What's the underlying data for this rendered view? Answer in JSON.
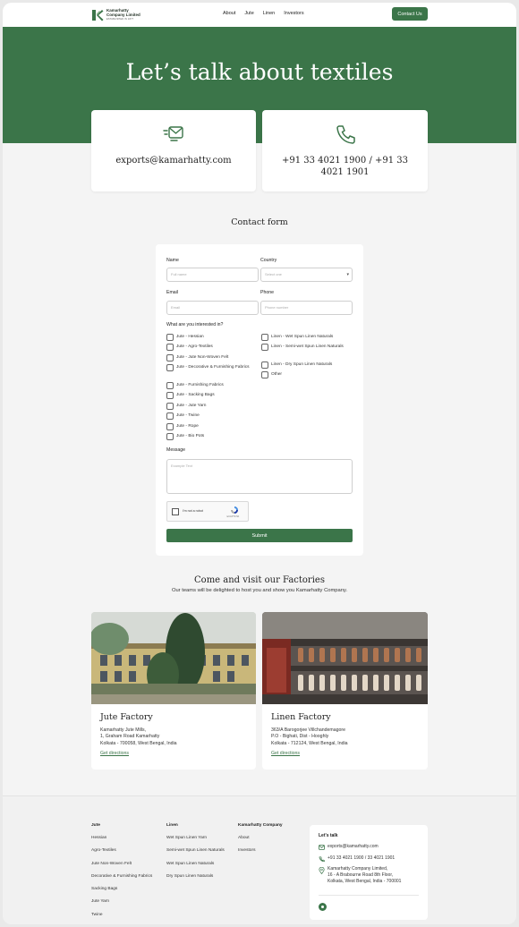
{
  "header": {
    "company_line1": "Kamarhatty",
    "company_line2": "Company Limited",
    "tagline": "ESTABLISHED IN 1877",
    "nav": [
      "About",
      "Jute",
      "Linen",
      "Investors"
    ],
    "cta": "Contact Us"
  },
  "hero": {
    "title": "Let’s talk about textiles",
    "email": "exports@kamarhatty.com",
    "phone": "+91 33 4021 1900 / +91 33 4021 1901"
  },
  "form": {
    "title": "Contact form",
    "name_label": "Name",
    "name_placeholder": "Full name",
    "country_label": "Country",
    "country_value": "Select one",
    "email_label": "Email",
    "email_placeholder": "Email",
    "phone_label": "Phone",
    "phone_placeholder": "Phone number",
    "interest_label": "What are you interested in?",
    "interests_left": [
      "Jute - Hessian",
      "Jute - Agro-Textiles",
      "Jute - Jute Non-Woven Felt",
      "Jute - Decorative & Furnishing Fabrics",
      "Jute - Furnishing Fabrics",
      "Jute - Sacking Bags",
      "Jute - Jute Yarn",
      "Jute - Twine",
      "Jute - Rope",
      "Jute - Bio Pots"
    ],
    "interests_right": [
      "Linen - Wet Spun Linen Naturals",
      "Linen - Semi-wet Spun Linen Naturals",
      "Linen - Dry Spun Linen Naturals",
      "Other"
    ],
    "message_label": "Message",
    "message_placeholder": "Example Text",
    "captcha_text": "I'm not a robot",
    "captcha_brand": "reCAPTCHA",
    "submit": "Submit"
  },
  "factories": {
    "title": "Come and visit our Factories",
    "subtitle": "Our teams will be delighted to host you and show you Kamarhatty Company.",
    "jute": {
      "name": "Jute Factory",
      "addr1": "Kamarhatty Jute Mills,",
      "addr2": "1, Graham Road Kamarhatty",
      "addr3": "Kolkata - 700058, West Bengal, India",
      "link": "Get directions"
    },
    "linen": {
      "name": "Linen Factory",
      "addr1": "363/A Barogorjee Villchandemagore",
      "addr2": "P.O - Bighati, Dist - Hooghly",
      "addr3": "Kolkata - 712124, West Bengal, India",
      "link": "Get directions"
    }
  },
  "footer": {
    "jute_heading": "Jute",
    "jute_items": [
      "Hessian",
      "Agro-Textiles",
      "Jute Non-Woven Felt",
      "Decorative & Furnishing Fabrics",
      "Sacking Bags",
      "Jute Yarn",
      "Twine"
    ],
    "linen_heading": "Linen",
    "linen_items": [
      "Wet Spun Linen Yarn",
      "Semi-wet Spun Linen Naturals",
      "Wet Spun Linen Naturals",
      "Dry Spun Linen Naturals"
    ],
    "company_heading": "Kamarhatty Company",
    "company_items": [
      "About",
      "Investors"
    ],
    "talk_heading": "Let's talk",
    "talk_email": "exports@kamarhatty.com",
    "talk_phone": "+91 33 4021 1900 / 33 4021 1901",
    "talk_addr1": "Kamarhatty Company Limited,",
    "talk_addr2": "16 - A Brabourne Road 8th Floor,",
    "talk_addr3": "Kolkata, West Bengal, India - 700001"
  },
  "colors": {
    "brand_green": "#3b7549",
    "page_bg": "#f4f4f4"
  }
}
